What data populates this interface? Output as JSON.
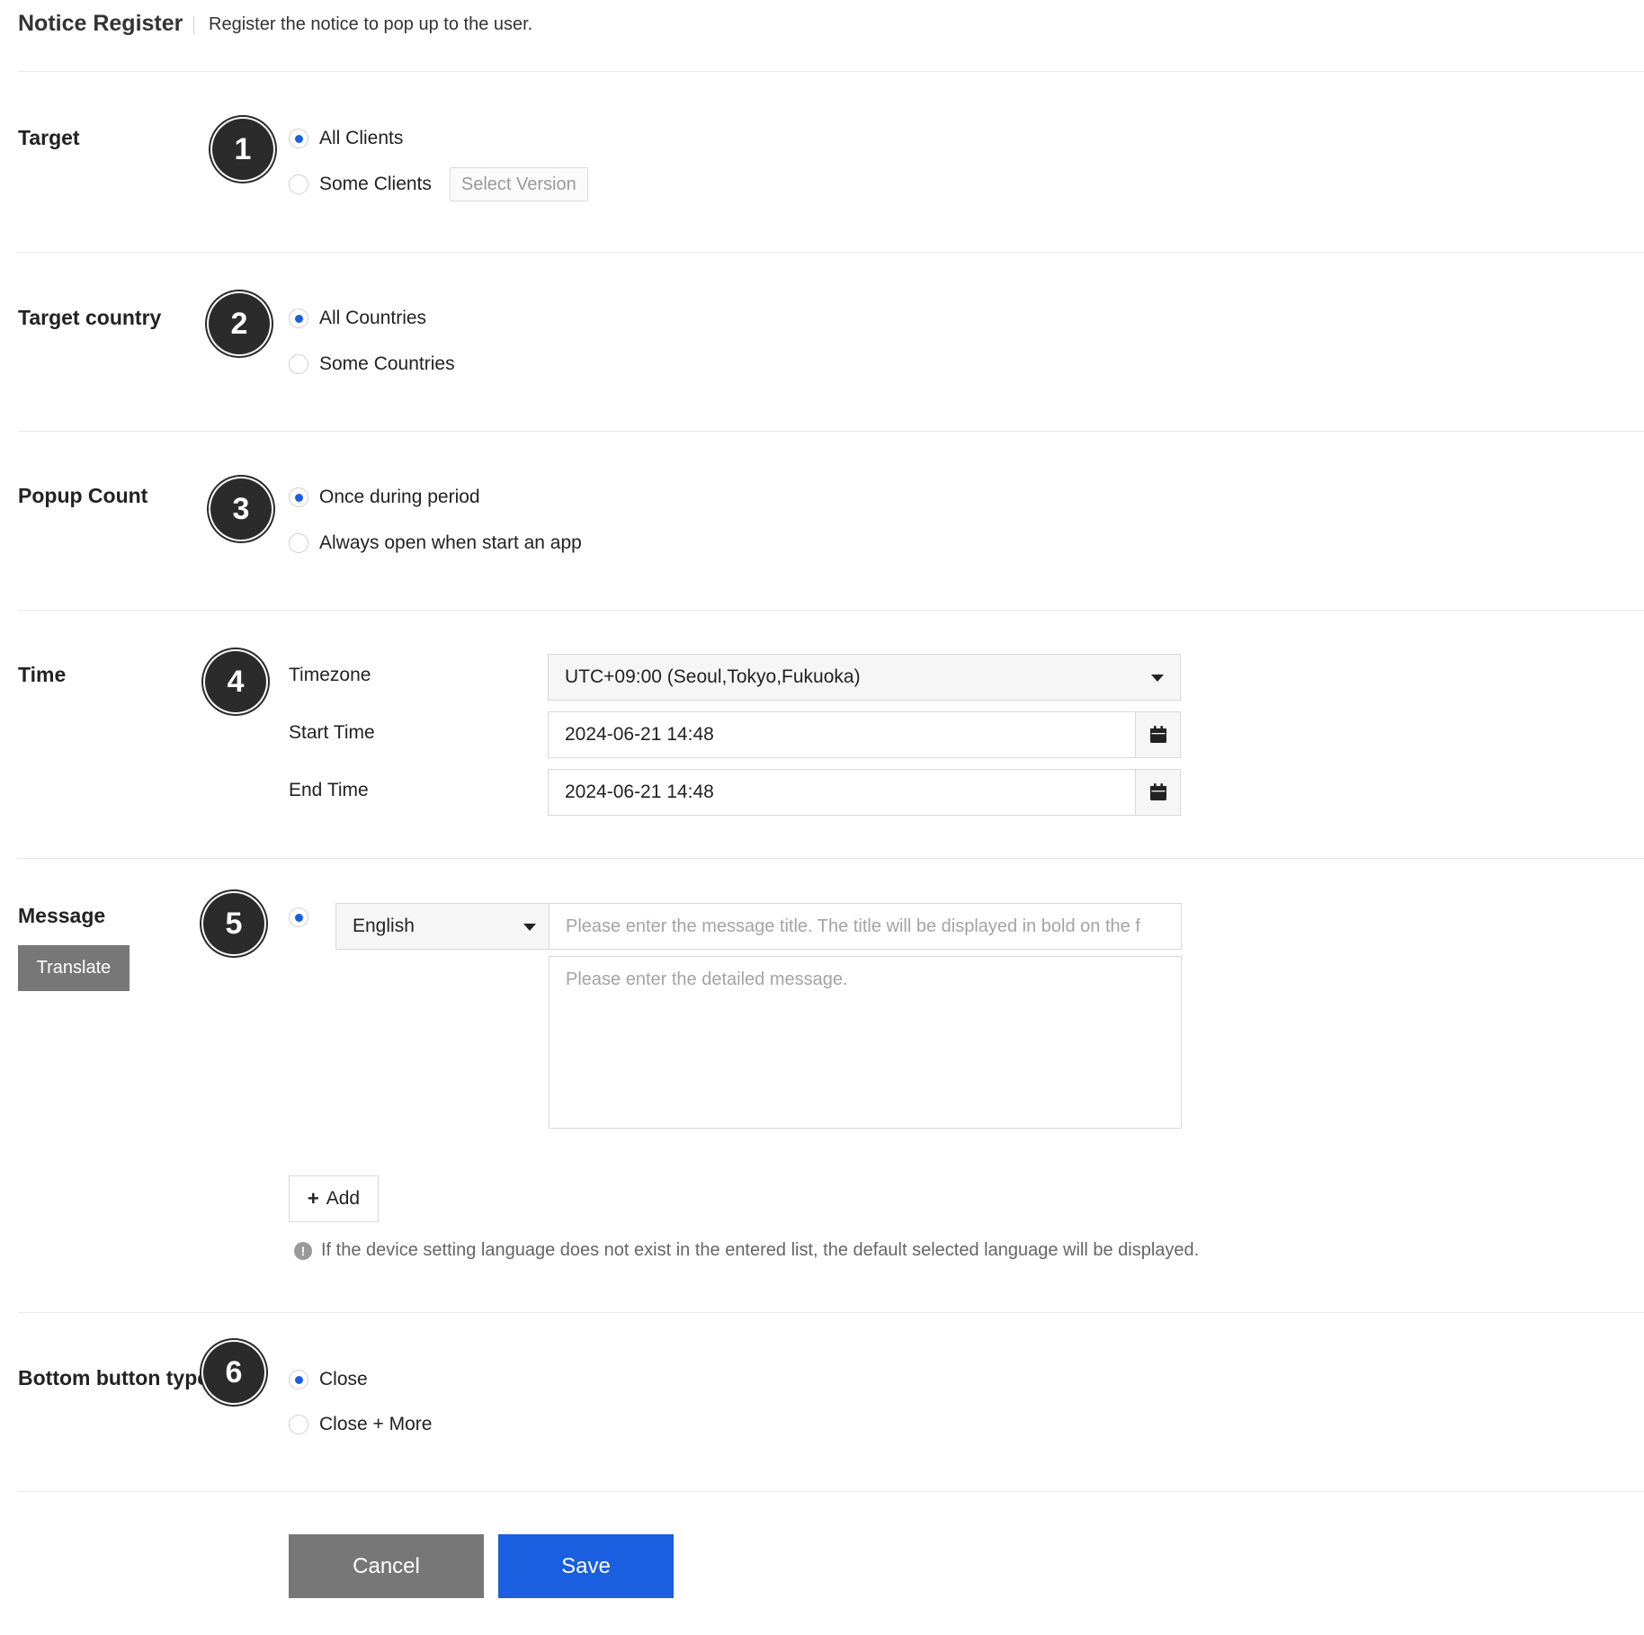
{
  "header": {
    "title": "Notice Register",
    "subtitle": "Register the notice to pop up to the user."
  },
  "target": {
    "label": "Target",
    "badge": "1",
    "options": [
      "All Clients",
      "Some Clients"
    ],
    "selected": 0,
    "select_version_label": "Select Version"
  },
  "target_country": {
    "label": "Target country",
    "badge": "2",
    "options": [
      "All Countries",
      "Some Countries"
    ],
    "selected": 0
  },
  "popup_count": {
    "label": "Popup Count",
    "badge": "3",
    "options": [
      "Once during period",
      "Always open when start an app"
    ],
    "selected": 0
  },
  "time": {
    "label": "Time",
    "badge": "4",
    "timezone_label": "Timezone",
    "timezone_value": "UTC+09:00 (Seoul,Tokyo,Fukuoka)",
    "start_label": "Start Time",
    "start_value": "2024-06-21 14:48",
    "end_label": "End Time",
    "end_value": "2024-06-21 14:48"
  },
  "message": {
    "label": "Message",
    "badge": "5",
    "translate_label": "Translate",
    "language": "English",
    "title_placeholder": "Please enter the message title. The title will be displayed in bold on the f",
    "body_placeholder": "Please enter the detailed message.",
    "add_label": "Add",
    "info_text": "If the device setting language does not exist in the entered list, the default selected language will be displayed."
  },
  "bottom_button": {
    "label": "Bottom button type",
    "badge": "6",
    "options": [
      "Close",
      "Close + More"
    ],
    "selected": 0
  },
  "actions": {
    "cancel_label": "Cancel",
    "save_label": "Save"
  },
  "colors": {
    "accent": "#1a5fe0",
    "badge": "#2b2b2b",
    "secondary_button": "#777777"
  },
  "icons": [
    "calendar-icon",
    "chevron-down-icon",
    "plus-icon",
    "info-icon"
  ]
}
